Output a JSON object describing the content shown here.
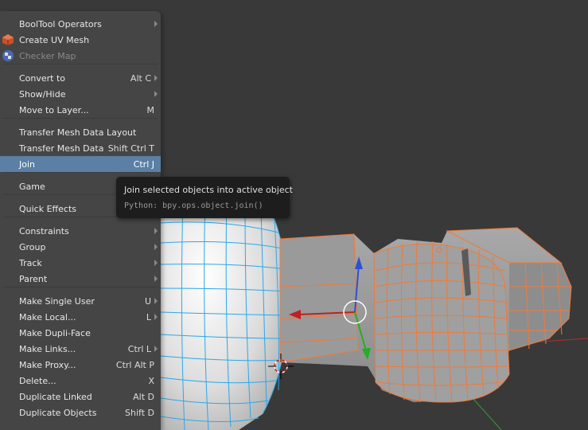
{
  "menu": {
    "items": [
      {
        "label": "BoolTool Operators",
        "shortcut": "",
        "submenu": true
      },
      {
        "label": "Create UV Mesh",
        "shortcut": "",
        "icon": "uv-mesh-icon"
      },
      {
        "label": "Checker Map",
        "shortcut": "",
        "icon": "checker-map-icon",
        "disabled": true
      },
      {
        "label": "Convert to",
        "shortcut": "Alt C",
        "submenu": true
      },
      {
        "label": "Show/Hide",
        "shortcut": "",
        "submenu": true
      },
      {
        "label": "Move to Layer...",
        "shortcut": "M"
      },
      {
        "label": "Transfer Mesh Data Layout",
        "shortcut": ""
      },
      {
        "label": "Transfer Mesh Data",
        "shortcut": "Shift Ctrl T"
      },
      {
        "label": "Join",
        "shortcut": "Ctrl J",
        "highlighted": true
      },
      {
        "label": "Game",
        "shortcut": "",
        "submenu": true
      },
      {
        "label": "Quick Effects",
        "shortcut": "",
        "submenu": true
      },
      {
        "label": "Constraints",
        "shortcut": "",
        "submenu": true
      },
      {
        "label": "Group",
        "shortcut": "",
        "submenu": true
      },
      {
        "label": "Track",
        "shortcut": "",
        "submenu": true
      },
      {
        "label": "Parent",
        "shortcut": "",
        "submenu": true
      },
      {
        "label": "Make Single User",
        "shortcut": "U",
        "submenu": true
      },
      {
        "label": "Make Local...",
        "shortcut": "L",
        "submenu": true
      },
      {
        "label": "Make Dupli-Face",
        "shortcut": ""
      },
      {
        "label": "Make Links...",
        "shortcut": "Ctrl L",
        "submenu": true
      },
      {
        "label": "Make Proxy...",
        "shortcut": "Ctrl Alt P"
      },
      {
        "label": "Delete...",
        "shortcut": "X"
      },
      {
        "label": "Duplicate Linked",
        "shortcut": "Alt D"
      },
      {
        "label": "Duplicate Objects",
        "shortcut": "Shift D"
      }
    ]
  },
  "tooltip": {
    "description": "Join selected objects into active object",
    "python": "Python: bpy.ops.object.join()"
  },
  "colors": {
    "background": "#393939",
    "menu": "#454545",
    "highlight": "#5b7fa5",
    "selected_wire": "#f07a3a",
    "wire_blue": "#2aa8e8"
  }
}
